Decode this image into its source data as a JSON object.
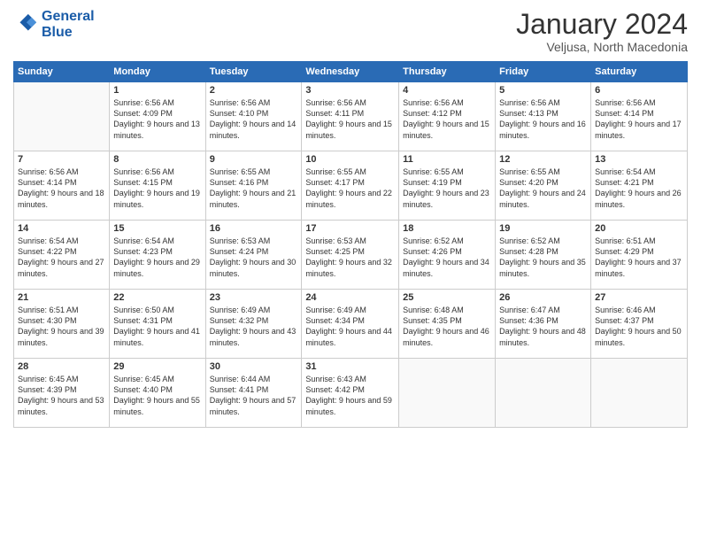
{
  "header": {
    "logo_line1": "General",
    "logo_line2": "Blue",
    "title": "January 2024",
    "subtitle": "Veljusa, North Macedonia"
  },
  "calendar": {
    "days_of_week": [
      "Sunday",
      "Monday",
      "Tuesday",
      "Wednesday",
      "Thursday",
      "Friday",
      "Saturday"
    ],
    "weeks": [
      [
        {
          "day": "",
          "sunrise": "",
          "sunset": "",
          "daylight": ""
        },
        {
          "day": "1",
          "sunrise": "6:56 AM",
          "sunset": "4:09 PM",
          "daylight": "9 hours and 13 minutes."
        },
        {
          "day": "2",
          "sunrise": "6:56 AM",
          "sunset": "4:10 PM",
          "daylight": "9 hours and 14 minutes."
        },
        {
          "day": "3",
          "sunrise": "6:56 AM",
          "sunset": "4:11 PM",
          "daylight": "9 hours and 15 minutes."
        },
        {
          "day": "4",
          "sunrise": "6:56 AM",
          "sunset": "4:12 PM",
          "daylight": "9 hours and 15 minutes."
        },
        {
          "day": "5",
          "sunrise": "6:56 AM",
          "sunset": "4:13 PM",
          "daylight": "9 hours and 16 minutes."
        },
        {
          "day": "6",
          "sunrise": "6:56 AM",
          "sunset": "4:14 PM",
          "daylight": "9 hours and 17 minutes."
        }
      ],
      [
        {
          "day": "7",
          "sunrise": "6:56 AM",
          "sunset": "4:14 PM",
          "daylight": "9 hours and 18 minutes."
        },
        {
          "day": "8",
          "sunrise": "6:56 AM",
          "sunset": "4:15 PM",
          "daylight": "9 hours and 19 minutes."
        },
        {
          "day": "9",
          "sunrise": "6:55 AM",
          "sunset": "4:16 PM",
          "daylight": "9 hours and 21 minutes."
        },
        {
          "day": "10",
          "sunrise": "6:55 AM",
          "sunset": "4:17 PM",
          "daylight": "9 hours and 22 minutes."
        },
        {
          "day": "11",
          "sunrise": "6:55 AM",
          "sunset": "4:19 PM",
          "daylight": "9 hours and 23 minutes."
        },
        {
          "day": "12",
          "sunrise": "6:55 AM",
          "sunset": "4:20 PM",
          "daylight": "9 hours and 24 minutes."
        },
        {
          "day": "13",
          "sunrise": "6:54 AM",
          "sunset": "4:21 PM",
          "daylight": "9 hours and 26 minutes."
        }
      ],
      [
        {
          "day": "14",
          "sunrise": "6:54 AM",
          "sunset": "4:22 PM",
          "daylight": "9 hours and 27 minutes."
        },
        {
          "day": "15",
          "sunrise": "6:54 AM",
          "sunset": "4:23 PM",
          "daylight": "9 hours and 29 minutes."
        },
        {
          "day": "16",
          "sunrise": "6:53 AM",
          "sunset": "4:24 PM",
          "daylight": "9 hours and 30 minutes."
        },
        {
          "day": "17",
          "sunrise": "6:53 AM",
          "sunset": "4:25 PM",
          "daylight": "9 hours and 32 minutes."
        },
        {
          "day": "18",
          "sunrise": "6:52 AM",
          "sunset": "4:26 PM",
          "daylight": "9 hours and 34 minutes."
        },
        {
          "day": "19",
          "sunrise": "6:52 AM",
          "sunset": "4:28 PM",
          "daylight": "9 hours and 35 minutes."
        },
        {
          "day": "20",
          "sunrise": "6:51 AM",
          "sunset": "4:29 PM",
          "daylight": "9 hours and 37 minutes."
        }
      ],
      [
        {
          "day": "21",
          "sunrise": "6:51 AM",
          "sunset": "4:30 PM",
          "daylight": "9 hours and 39 minutes."
        },
        {
          "day": "22",
          "sunrise": "6:50 AM",
          "sunset": "4:31 PM",
          "daylight": "9 hours and 41 minutes."
        },
        {
          "day": "23",
          "sunrise": "6:49 AM",
          "sunset": "4:32 PM",
          "daylight": "9 hours and 43 minutes."
        },
        {
          "day": "24",
          "sunrise": "6:49 AM",
          "sunset": "4:34 PM",
          "daylight": "9 hours and 44 minutes."
        },
        {
          "day": "25",
          "sunrise": "6:48 AM",
          "sunset": "4:35 PM",
          "daylight": "9 hours and 46 minutes."
        },
        {
          "day": "26",
          "sunrise": "6:47 AM",
          "sunset": "4:36 PM",
          "daylight": "9 hours and 48 minutes."
        },
        {
          "day": "27",
          "sunrise": "6:46 AM",
          "sunset": "4:37 PM",
          "daylight": "9 hours and 50 minutes."
        }
      ],
      [
        {
          "day": "28",
          "sunrise": "6:45 AM",
          "sunset": "4:39 PM",
          "daylight": "9 hours and 53 minutes."
        },
        {
          "day": "29",
          "sunrise": "6:45 AM",
          "sunset": "4:40 PM",
          "daylight": "9 hours and 55 minutes."
        },
        {
          "day": "30",
          "sunrise": "6:44 AM",
          "sunset": "4:41 PM",
          "daylight": "9 hours and 57 minutes."
        },
        {
          "day": "31",
          "sunrise": "6:43 AM",
          "sunset": "4:42 PM",
          "daylight": "9 hours and 59 minutes."
        },
        {
          "day": "",
          "sunrise": "",
          "sunset": "",
          "daylight": ""
        },
        {
          "day": "",
          "sunrise": "",
          "sunset": "",
          "daylight": ""
        },
        {
          "day": "",
          "sunrise": "",
          "sunset": "",
          "daylight": ""
        }
      ]
    ]
  }
}
